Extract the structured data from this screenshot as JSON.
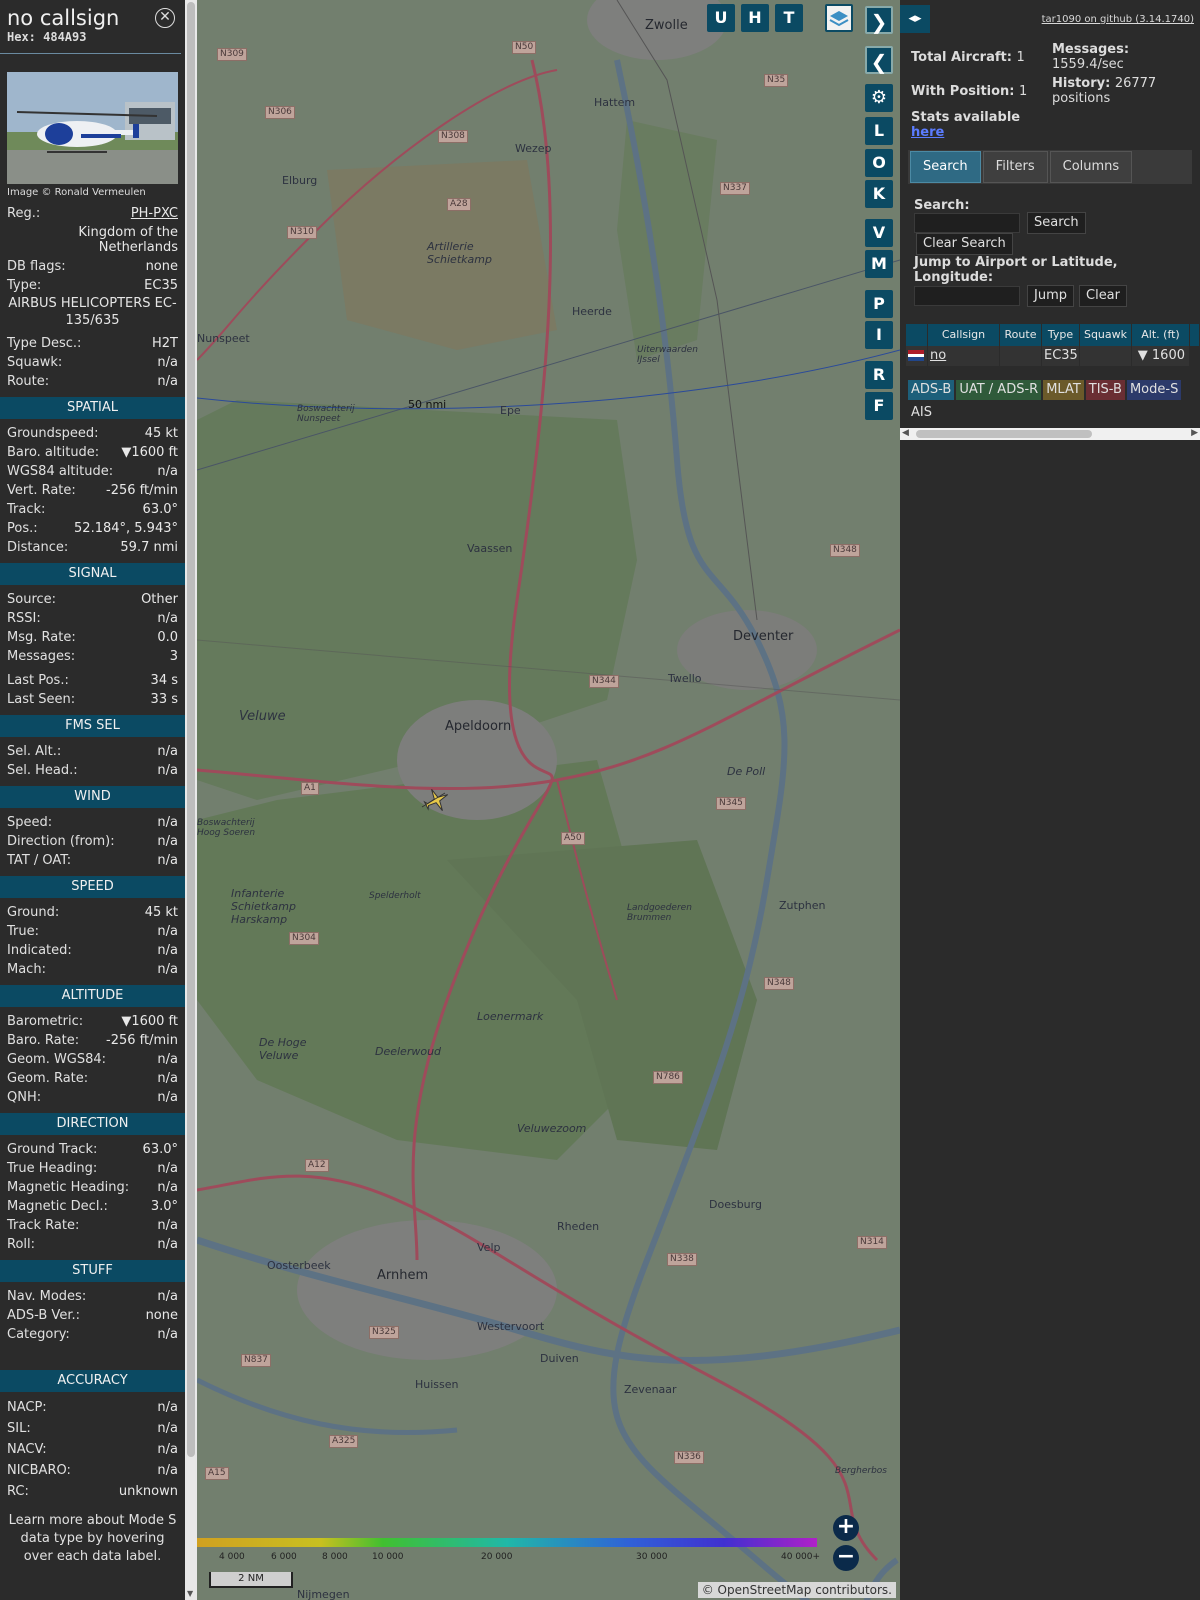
{
  "info": {
    "callsign": "no callsign",
    "hex": "Hex: 484A93",
    "photo_credit": "Image © Ronald Vermeulen",
    "rows1": [
      {
        "label": "Reg.:",
        "value": "PH-PXC"
      },
      {
        "label": "",
        "value": "Kingdom of the Netherlands"
      },
      {
        "label": "DB flags:",
        "value": "none"
      },
      {
        "label": "Type:",
        "value": "EC35"
      }
    ],
    "type_full": "AIRBUS HELICOPTERS EC-135/635",
    "rows2": [
      {
        "label": "Type Desc.:",
        "value": "H2T"
      },
      {
        "label": "Squawk:",
        "value": "n/a"
      },
      {
        "label": "Route:",
        "value": "n/a"
      }
    ],
    "sections": [
      {
        "title": "SPATIAL",
        "rows": [
          {
            "label": "Groundspeed:",
            "value": "45 kt"
          },
          {
            "label": "Baro. altitude:",
            "value": "▼1600 ft"
          },
          {
            "label": "WGS84 altitude:",
            "value": "n/a"
          },
          {
            "label": "Vert. Rate:",
            "value": "-256 ft/min"
          },
          {
            "label": "Track:",
            "value": "63.0°"
          },
          {
            "label": "Pos.:",
            "value": "52.184°, 5.943°"
          },
          {
            "label": "Distance:",
            "value": "59.7 nmi"
          }
        ]
      },
      {
        "title": "SIGNAL",
        "rows": [
          {
            "label": "Source:",
            "value": "Other"
          },
          {
            "label": "RSSI:",
            "value": "n/a"
          },
          {
            "label": "Msg. Rate:",
            "value": "0.0"
          },
          {
            "label": "Messages:",
            "value": "3"
          },
          {
            "label": "Last Pos.:",
            "value": "34 s"
          },
          {
            "label": "Last Seen:",
            "value": "33 s"
          }
        ]
      },
      {
        "title": "FMS SEL",
        "rows": [
          {
            "label": "Sel. Alt.:",
            "value": "n/a"
          },
          {
            "label": "Sel. Head.:",
            "value": "n/a"
          }
        ]
      },
      {
        "title": "WIND",
        "rows": [
          {
            "label": "Speed:",
            "value": "n/a"
          },
          {
            "label": "Direction (from):",
            "value": "n/a"
          },
          {
            "label": "TAT / OAT:",
            "value": "n/a"
          }
        ]
      },
      {
        "title": "SPEED",
        "rows": [
          {
            "label": "Ground:",
            "value": "45 kt"
          },
          {
            "label": "True:",
            "value": "n/a"
          },
          {
            "label": "Indicated:",
            "value": "n/a"
          },
          {
            "label": "Mach:",
            "value": "n/a"
          }
        ]
      },
      {
        "title": "ALTITUDE",
        "rows": [
          {
            "label": "Barometric:",
            "value": "▼1600 ft"
          },
          {
            "label": "Baro. Rate:",
            "value": "-256 ft/min"
          },
          {
            "label": "Geom. WGS84:",
            "value": "n/a"
          },
          {
            "label": "Geom. Rate:",
            "value": "n/a"
          },
          {
            "label": "QNH:",
            "value": "n/a"
          }
        ]
      },
      {
        "title": "DIRECTION",
        "rows": [
          {
            "label": "Ground Track:",
            "value": "63.0°"
          },
          {
            "label": "True Heading:",
            "value": "n/a"
          },
          {
            "label": "Magnetic Heading:",
            "value": "n/a"
          },
          {
            "label": "Magnetic Decl.:",
            "value": "3.0°"
          },
          {
            "label": "Track Rate:",
            "value": "n/a"
          },
          {
            "label": "Roll:",
            "value": "n/a"
          }
        ]
      },
      {
        "title": "STUFF",
        "rows": [
          {
            "label": "Nav. Modes:",
            "value": "n/a"
          },
          {
            "label": "ADS-B Ver.:",
            "value": "none"
          },
          {
            "label": "Category:",
            "value": "n/a"
          }
        ]
      },
      {
        "title": "ACCURACY",
        "rows": [
          {
            "label": "NACP:",
            "value": "n/a"
          },
          {
            "label": "SIL:",
            "value": "n/a"
          },
          {
            "label": "NACV:",
            "value": "n/a"
          },
          {
            "label": "NICBARO:",
            "value": "n/a"
          },
          {
            "label": "RC:",
            "value": "unknown"
          }
        ]
      }
    ],
    "footer": "Learn more about Mode S data type by hovering over each data label."
  },
  "map": {
    "buttons_top": [
      "U",
      "H",
      "T"
    ],
    "buttons_side": [
      "L",
      "O",
      "K",
      "V",
      "M",
      "P",
      "I",
      "R",
      "F"
    ],
    "range_ring_label": "50 nmi",
    "scale_bar": "2 NM",
    "attribution": "© OpenStreetMap contributors.",
    "colorbar_ticks": [
      "4 000",
      "6 000",
      "8 000",
      "10 000",
      "20 000",
      "30 000",
      "40 000+"
    ],
    "cities": [
      "Zwolle",
      "Hattem",
      "Wezep",
      "Elburg",
      "Heerde",
      "Epe",
      "Vaassen",
      "Deventer",
      "Twello",
      "Apeldoorn",
      "Zutphen",
      "Doesburg",
      "Rheden",
      "Velp",
      "Arnhem",
      "Oosterbeek",
      "Westervoort",
      "Duiven",
      "Huissen",
      "Zevenaar",
      "Nijmegen"
    ],
    "places": [
      "Artillerie Schietkamp",
      "Veluwe",
      "Infanterie Schietkamp Harskamp",
      "De Hoge Veluwe",
      "Veluwezoom",
      "Deelerwoud",
      "Loenermark",
      "Spelderholt",
      "Landgoederen Brummen",
      "De Poll",
      "Bergherbos",
      "Uiterwaarden IJssel",
      "Boswachterij Nunspeet",
      "Nunspeet",
      "Boswachterij Hoog Soeren"
    ],
    "roads": [
      "N50",
      "N35",
      "N309",
      "N306",
      "N308",
      "N337",
      "N310",
      "A28",
      "N348",
      "N344",
      "N345",
      "A1",
      "A50",
      "N304",
      "N348",
      "N786",
      "A12",
      "N325",
      "N338",
      "N314",
      "N837",
      "N336",
      "A325",
      "A15"
    ]
  },
  "sidebar": {
    "toggle_icon": "◂▸",
    "github": "tar1090 on github (3.14.1740)",
    "total_aircraft_label": "Total Aircraft:",
    "total_aircraft": "1",
    "with_position_label": "With Position:",
    "with_position": "1",
    "stats_label": "Stats available",
    "stats_link": "here",
    "messages_label": "Messages:",
    "messages_rate": "1559.4/sec",
    "history_label": "History:",
    "history_value": "26777 positions",
    "tabs": [
      "Search",
      "Filters",
      "Columns"
    ],
    "search_label": "Search:",
    "search_button": "Search",
    "clear_search_button": "Clear Search",
    "jump_label": "Jump to Airport or Latitude, Longitude:",
    "jump_button": "Jump",
    "clear_button": "Clear",
    "table": {
      "headers": [
        "Callsign",
        "Route",
        "Type",
        "Squawk",
        "Alt. (ft)"
      ],
      "row": {
        "callsign": "no callsign",
        "route": "",
        "type": "EC35",
        "squawk": "",
        "alt": "▼ 1600"
      }
    },
    "chips": [
      {
        "label": "ADS-B",
        "color": "#1d5f7a"
      },
      {
        "label": "UAT / ADS-R",
        "color": "#2f5a3a"
      },
      {
        "label": "MLAT",
        "color": "#6b5a2a"
      },
      {
        "label": "TIS-B",
        "color": "#6a2e33"
      },
      {
        "label": "Mode-S",
        "color": "#2c3a6a"
      },
      {
        "label": "AIS",
        "color": "#2b2b2b"
      }
    ]
  }
}
